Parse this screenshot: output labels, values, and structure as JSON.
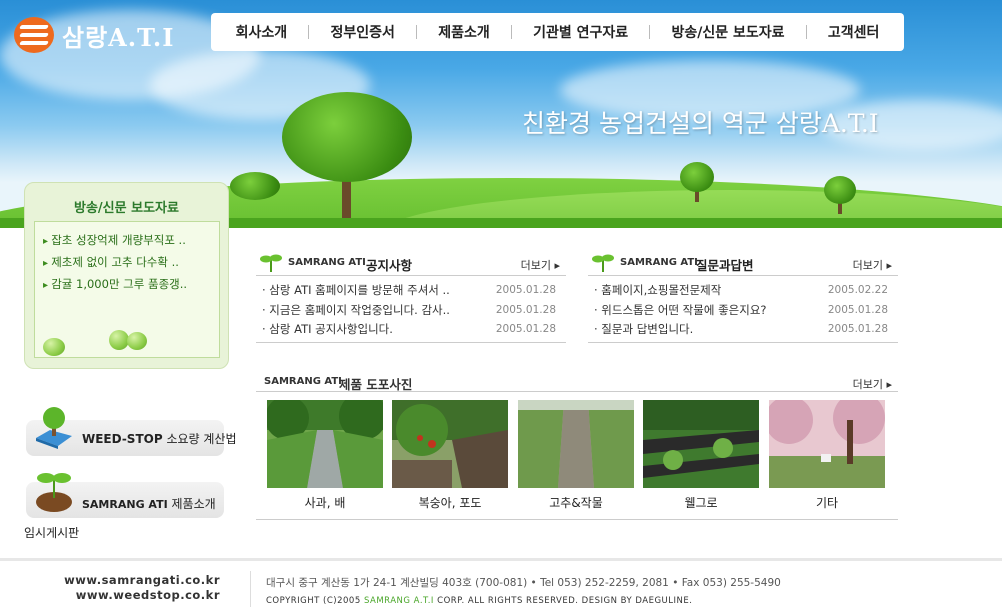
{
  "header": {
    "logo_text": "삼랑A.T.I",
    "nav": [
      "회사소개",
      "정부인증서",
      "제품소개",
      "기관별 연구자료",
      "방송/신문 보도자료",
      "고객센터"
    ],
    "slogan": "친환경 농업건설의 역군 삼랑A.T.I"
  },
  "sidebar": {
    "press_title": "방송/신문 보도자료",
    "press_items": [
      "잡초 성장억제 개량부직포 ..",
      "제초제 없이 고추 다수확 ..",
      "감귤 1,000만 그루 품종갱.."
    ],
    "weedstop_brand": "WEED-STOP",
    "weedstop_label": " 소요량 계산법",
    "product_brand": "SAMRANG ATI",
    "product_label": " 제품소개",
    "temp_board": "임시게시판"
  },
  "notice": {
    "brand": "SAMRANG ATI",
    "title": "공지사항",
    "more": "더보기 ▸",
    "items": [
      {
        "text": "· 삼랑 ATI 홈페이지를 방문해 주셔서 ..",
        "date": "2005.01.28"
      },
      {
        "text": "· 지금은 홈페이지 작업중입니다. 감사..",
        "date": "2005.01.28"
      },
      {
        "text": "· 삼랑 ATI 공지사항입니다.",
        "date": "2005.01.28"
      }
    ]
  },
  "qna": {
    "brand": "SAMRANG ATI",
    "title": "질문과답변",
    "more": "더보기 ▸",
    "items": [
      {
        "text": "· 홈페이지,쇼핑몰전문제작",
        "date": "2005.02.22"
      },
      {
        "text": "· 위드스톱은 어떤 작물에 좋은지요?",
        "date": "2005.01.28"
      },
      {
        "text": "· 질문과 답변입니다.",
        "date": "2005.01.28"
      }
    ]
  },
  "gallery": {
    "brand": "SAMRANG ATI",
    "title": "제품 도포사진",
    "more": "더보기 ▸",
    "items": [
      "사과, 배",
      "복숭아, 포도",
      "고추&작물",
      "웰그로",
      "기타"
    ]
  },
  "footer": {
    "web1": "www.samrangati.co.kr",
    "web2": "www.weedstop.co.kr",
    "address": "대구시 중구 계산동 1가 24-1 계산빌딩 403호 (700-081)  •  Tel 053) 252-2259, 2081  •  Fax 053) 255-5490",
    "copy_pre": "COPYRIGHT (C)2005 ",
    "copy_brand": "SAMRANG A.T.I",
    "copy_post": " CORP. ALL RIGHTS RESERVED. DESIGN BY DAEGULINE."
  },
  "colors": {
    "accent_green": "#3c8c1e",
    "logo_orange": "#ee6a1e",
    "sky_blue": "#2a8fd6"
  }
}
